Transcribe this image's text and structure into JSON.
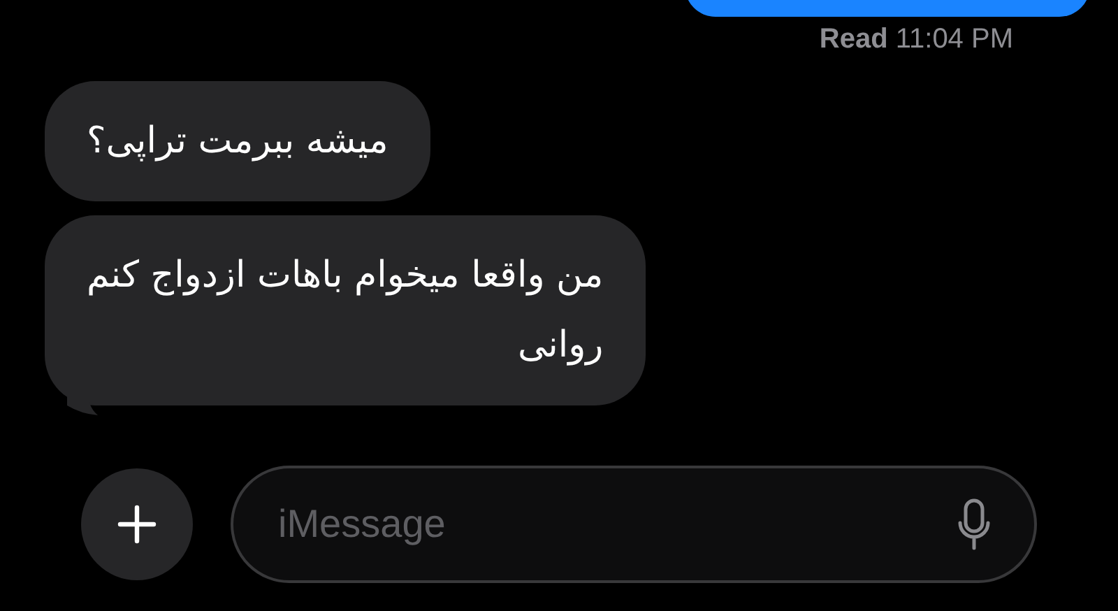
{
  "status": {
    "label": "Read",
    "time": "11:04 PM"
  },
  "messages": [
    {
      "text": "میشه ببرمت تراپی؟",
      "tail": false
    },
    {
      "text": "من واقعا میخوام باهات ازدواج کنم\nروانی",
      "tail": true
    }
  ],
  "composer": {
    "placeholder": "iMessage"
  }
}
